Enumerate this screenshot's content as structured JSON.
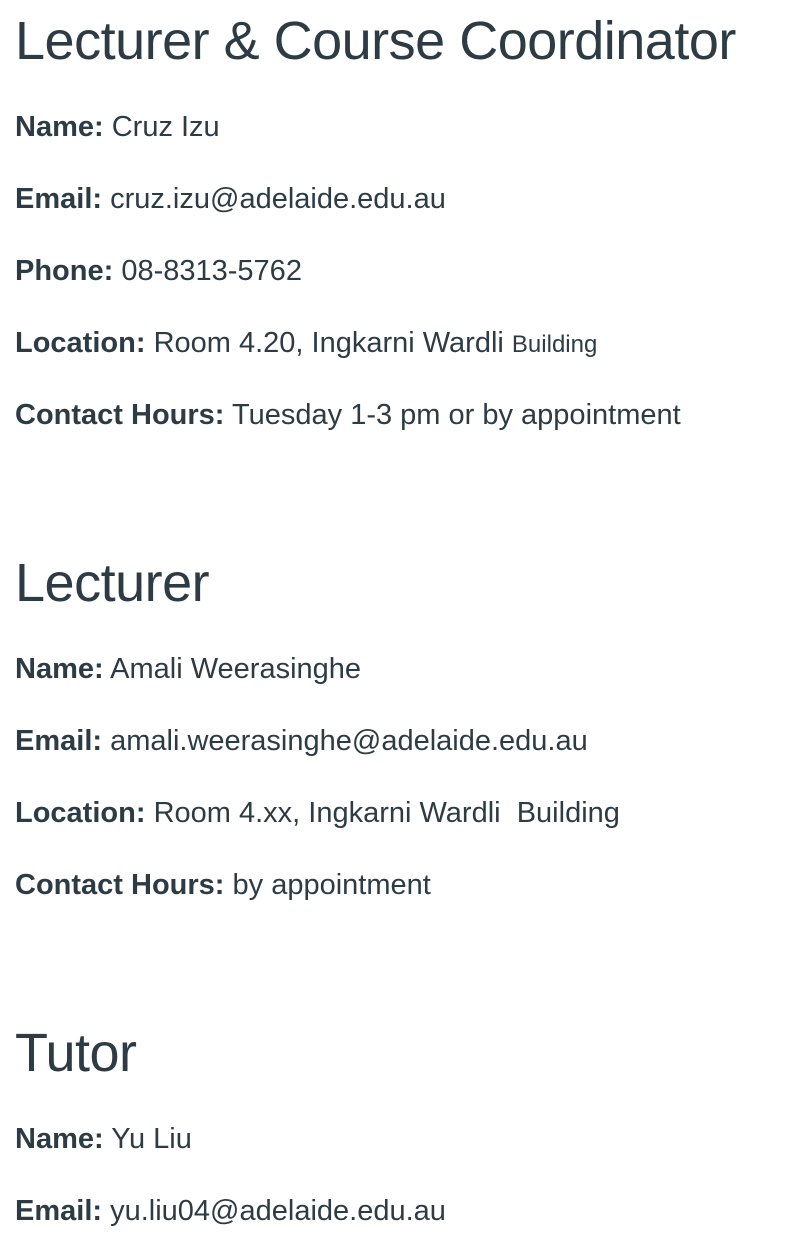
{
  "sections": [
    {
      "heading": "Lecturer & Course Coordinator",
      "fields": [
        {
          "label": "Name:",
          "value": "Cruz Izu"
        },
        {
          "label": "Email:",
          "value": "cruz.izu@adelaide.edu.au"
        },
        {
          "label": "Phone:",
          "value": "08-8313-5762"
        },
        {
          "label": "Location:",
          "value": "Room 4.20, Ingkarni Wardli",
          "value_suffix": "Building"
        },
        {
          "label": "Contact Hours:",
          "value": "Tuesday  1-3 pm or by appointment"
        }
      ]
    },
    {
      "heading": "Lecturer",
      "fields": [
        {
          "label": "Name:",
          "value": "Amali Weerasinghe"
        },
        {
          "label": "Email:",
          "value": "amali.weerasinghe@adelaide.edu.au"
        },
        {
          "label": "Location:",
          "value": "Room 4.xx, Ingkarni Wardli  Building"
        },
        {
          "label": "Contact Hours:",
          "value": "by appointment"
        }
      ]
    },
    {
      "heading": "Tutor",
      "fields": [
        {
          "label": "Name:",
          "value": "Yu Liu"
        },
        {
          "label": "Email:",
          "value": "yu.liu04@adelaide.edu.au"
        }
      ]
    }
  ]
}
